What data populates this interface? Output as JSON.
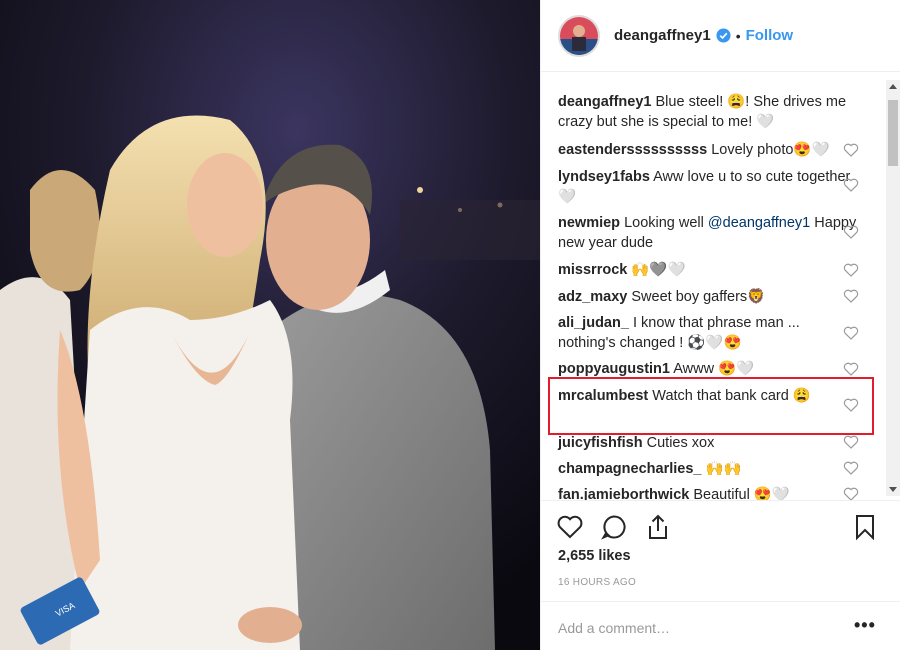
{
  "header": {
    "username": "deangaffney1",
    "separator": "•",
    "follow_label": "Follow"
  },
  "comments": [
    {
      "user": "deangaffney1",
      "text": "Blue steel! 😩! She drives me crazy but she is special to me! 🤍",
      "mention": ""
    },
    {
      "user": "eastenderssssssssss",
      "text": "Lovely photo😍🤍",
      "mention": ""
    },
    {
      "user": "lyndsey1fabs",
      "text": "Aww love u to so cute together 🤍",
      "mention": ""
    },
    {
      "user": "newmiep",
      "text": "Looking well ",
      "mention": "@deangaffney1",
      "text2": " Happy new year dude"
    },
    {
      "user": "missrrock",
      "text": "🙌🩶🤍",
      "mention": ""
    },
    {
      "user": "adz_maxy",
      "text": "Sweet boy gaffers🦁",
      "mention": ""
    },
    {
      "user": "ali_judan_",
      "text": "I know that phrase man ... nothing's changed ! ⚽🤍😍",
      "mention": ""
    },
    {
      "user": "poppyaugustin1",
      "text": "Awww 😍🤍",
      "mention": ""
    },
    {
      "user": "mrcalumbest",
      "text": "Watch that bank card 😩",
      "mention": ""
    },
    {
      "user": "juicyfishfish",
      "text": "Cuties xox",
      "mention": ""
    },
    {
      "user": "champagnecharlies_",
      "text": "🙌🙌",
      "mention": ""
    },
    {
      "user": "fan.jamieborthwick",
      "text": "Beautiful 😍🤍",
      "mention": ""
    }
  ],
  "likes": "2,655 likes",
  "timestamp": "16 HOURS AGO",
  "add_comment_placeholder": "Add a comment…",
  "more_label": "•••",
  "colors": {
    "accent": "#3897f0",
    "highlight": "#e21c2a",
    "text": "#262626",
    "muted": "#999999"
  },
  "icons": [
    "verified-icon",
    "heart-icon",
    "comment-icon",
    "share-icon",
    "bookmark-icon",
    "more-icon"
  ]
}
